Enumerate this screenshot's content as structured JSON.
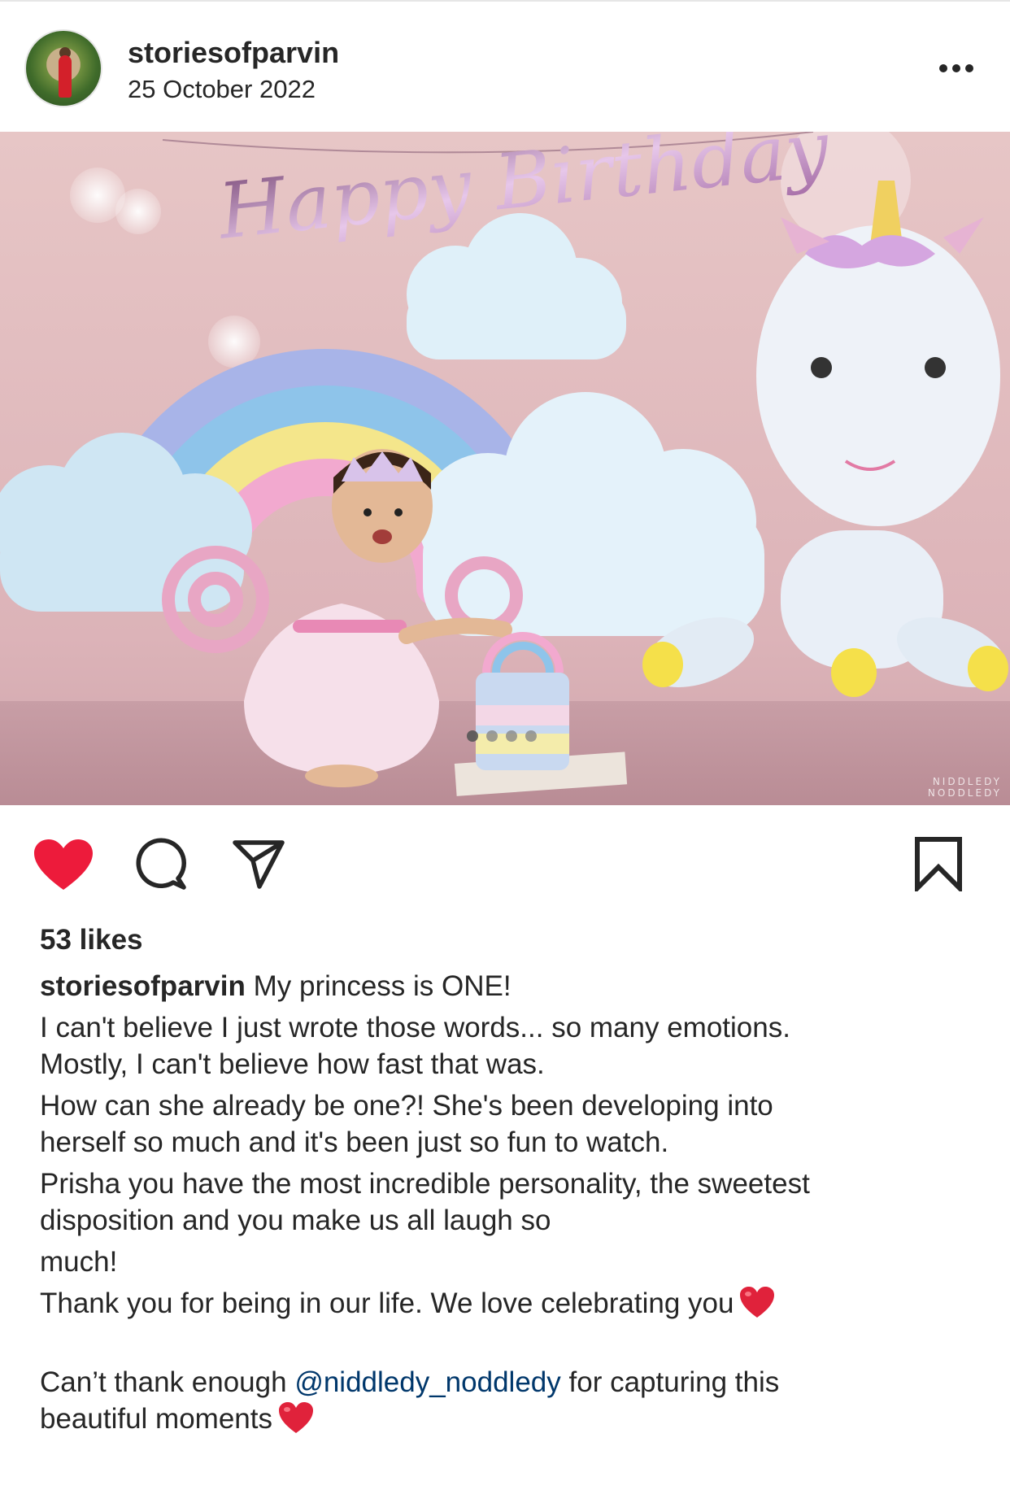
{
  "post": {
    "username": "storiesofparvin",
    "date": "25 October 2022",
    "likes": "53 likes",
    "photo": {
      "banner_text": "Happy Birthday",
      "watermark_line1": "NIDDLEDY",
      "watermark_line2": "NODDLEDY",
      "carousel_dots": 4
    },
    "caption": {
      "user": "storiesofparvin",
      "first": "My princess is ONE!",
      "l2": "I can't believe I just wrote those words... so many emotions.",
      "l3": "Mostly, I can't believe how fast that was.",
      "l4": "How can she already be one?! She's been developing into",
      "l5": "herself so much and it's been just so fun to watch.",
      "l6": "Prisha you have the most incredible personality, the sweetest",
      "l7": "disposition and you make us all laugh so",
      "l8": "much!",
      "l9": "Thank you for being in our life. We love celebrating you",
      "l10a": "Can’t thank enough",
      "mention": "@niddledy_noddledy",
      "l10b": "for capturing this",
      "l11": "beautiful moments"
    }
  },
  "icons": {
    "more": "more-options-icon",
    "like": "heart-icon",
    "comment": "comment-icon",
    "share": "share-icon",
    "save": "bookmark-icon",
    "emoji": "red-heart-emoji"
  },
  "colors": {
    "like_active": "#ed1b3b",
    "mention": "#00376b",
    "text": "#262626"
  }
}
